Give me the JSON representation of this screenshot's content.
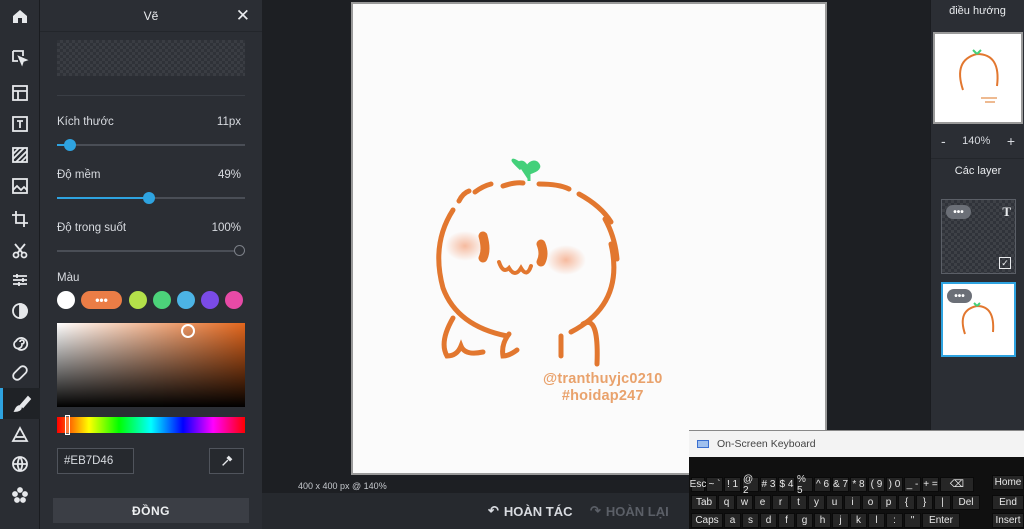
{
  "toolbar": {
    "tools": [
      {
        "name": "home-icon",
        "active": false
      },
      {
        "name": "select-arrow-icon",
        "active": false
      },
      {
        "name": "layout-icon",
        "active": false
      },
      {
        "name": "text-icon",
        "active": false
      },
      {
        "name": "texture-icon",
        "active": false
      },
      {
        "name": "image-icon",
        "active": false
      },
      {
        "name": "crop-icon",
        "active": false
      },
      {
        "name": "cut-icon",
        "active": false
      },
      {
        "name": "adjust-icon",
        "active": false
      },
      {
        "name": "contrast-icon",
        "active": false
      },
      {
        "name": "swirl-icon",
        "active": false
      },
      {
        "name": "bandage-icon",
        "active": false
      },
      {
        "name": "brush-icon",
        "active": true
      },
      {
        "name": "shape-icon",
        "active": false
      },
      {
        "name": "globe-icon",
        "active": false
      },
      {
        "name": "dots-flower-icon",
        "active": false
      }
    ]
  },
  "draw_panel": {
    "title": "Vẽ",
    "size_label": "Kích thước",
    "size_value": "11px",
    "size_fraction": 0.07,
    "softness_label": "Độ mềm",
    "softness_value": "49%",
    "softness_fraction": 0.49,
    "opacity_label": "Độ trong suốt",
    "opacity_value": "100%",
    "opacity_fraction": 1.0,
    "color_label": "Màu",
    "swatches": [
      "#ffffff",
      "#eb7d46",
      "#b4e14a",
      "#4cd37a",
      "#4cb4e6",
      "#7a4be6",
      "#e64aa6"
    ],
    "more_label": "•••",
    "hex_value": "#EB7D46",
    "done_label": "ĐỒNG",
    "accent": "#2ea3e0"
  },
  "canvas": {
    "watermark_line1": "@tranthuyjc0210",
    "watermark_line2": "#hoidap247",
    "info": "400 x 400 px @ 140%"
  },
  "actions": {
    "undo_label": "HOÀN TÁC",
    "redo_label": "HOÀN LẠI"
  },
  "right_panel": {
    "nav_title": "điều hướng",
    "zoom_value": "140%",
    "zoom_minus": "-",
    "zoom_plus": "+",
    "layers_title": "Các layer",
    "layer_text_icon": "T",
    "layer_dots": "•••",
    "layer_check": "✓"
  },
  "keyboard": {
    "title": "On-Screen Keyboard",
    "row1": [
      "Esc",
      "~",
      "!",
      "@",
      "#",
      "$",
      "%",
      "^",
      "&",
      "*",
      "(",
      ")",
      "_",
      "+",
      "⌫"
    ],
    "row1_sub": [
      "",
      "`",
      "1",
      "2",
      "3",
      "4",
      "5",
      "6",
      "7",
      "8",
      "9",
      "0",
      "-",
      "=",
      ""
    ],
    "row2": [
      "Tab",
      "q",
      "w",
      "e",
      "r",
      "t",
      "y",
      "u",
      "i",
      "o",
      "p",
      "{",
      "}",
      "|",
      "Del"
    ],
    "row3": [
      "Caps",
      "a",
      "s",
      "d",
      "f",
      "g",
      "h",
      "j",
      "k",
      "l",
      ":",
      "\"",
      "Enter"
    ],
    "side": [
      "Home",
      "End",
      "Insert"
    ]
  }
}
